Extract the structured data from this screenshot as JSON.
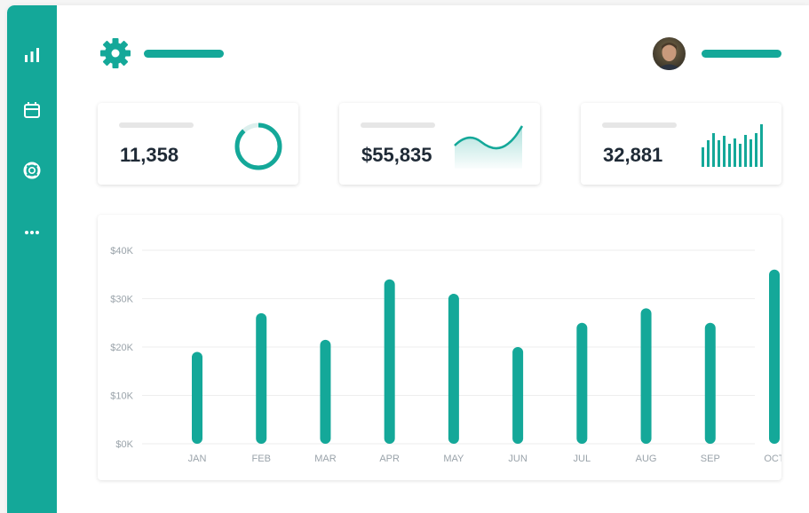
{
  "colors": {
    "accent": "#14a899",
    "text": "#1f2a36",
    "muted": "#9aa3aa"
  },
  "sidebar": {
    "items": [
      {
        "icon": "bar-chart-icon"
      },
      {
        "icon": "calendar-icon"
      },
      {
        "icon": "lifebuoy-icon"
      },
      {
        "icon": "more-icon"
      }
    ]
  },
  "header": {
    "settings_icon": "gear-icon"
  },
  "user": {
    "avatar_icon": "user-avatar"
  },
  "stats": [
    {
      "value": "11,358",
      "chart": "donut",
      "fraction": 0.88
    },
    {
      "value": "$55,835",
      "chart": "area-sparkline"
    },
    {
      "value": "32,881",
      "chart": "mini-bars"
    }
  ],
  "chart_data": {
    "type": "bar",
    "categories": [
      "JAN",
      "FEB",
      "MAR",
      "APR",
      "MAY",
      "JUN",
      "JUL",
      "AUG",
      "SEP",
      "OCT"
    ],
    "values": [
      19,
      27,
      21.5,
      34,
      31,
      20,
      25,
      28,
      25,
      36
    ],
    "y_ticks": [
      "$0K",
      "$10K",
      "$20K",
      "$30K",
      "$40K"
    ],
    "ylim": [
      0,
      40
    ],
    "grid": true,
    "title": "",
    "xlabel": "",
    "ylabel": ""
  }
}
